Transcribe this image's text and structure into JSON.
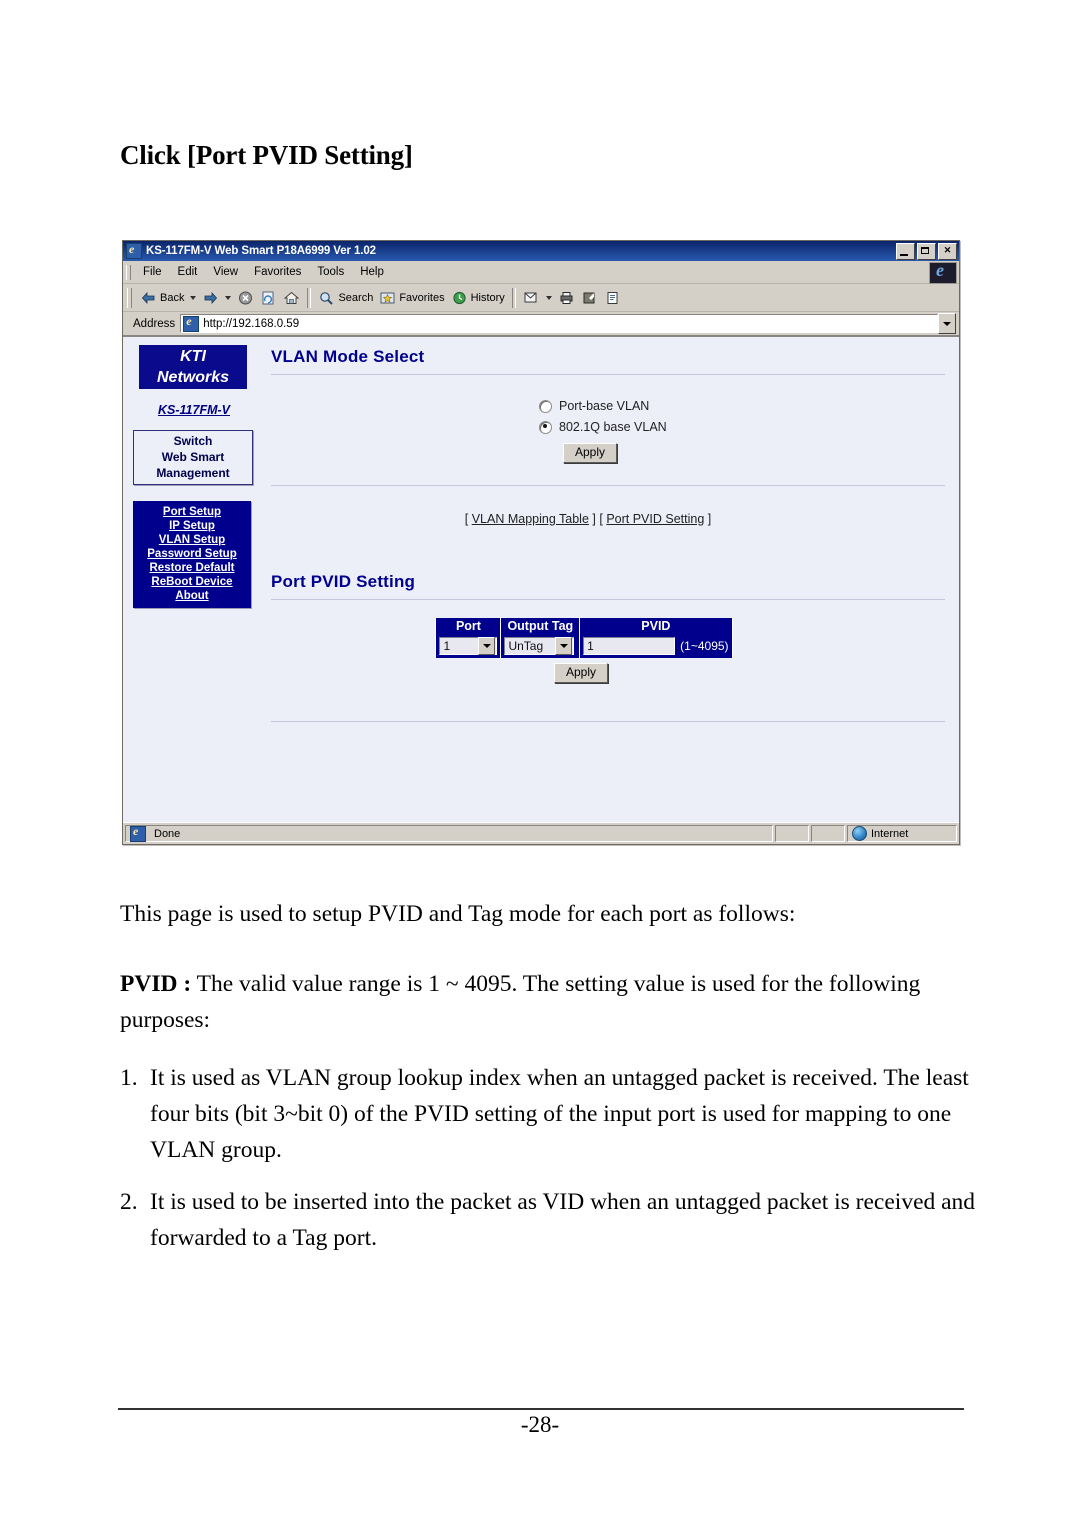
{
  "document": {
    "heading": "Click [Port PVID Setting]",
    "page_number": "-28-"
  },
  "browser": {
    "title": "KS-117FM-V Web Smart P18A6999 Ver 1.02",
    "window_controls": {
      "minimize": "_",
      "restore": "❐",
      "close": "✕"
    },
    "menu": [
      "File",
      "Edit",
      "View",
      "Favorites",
      "Tools",
      "Help"
    ],
    "toolbar": {
      "back": "Back",
      "forward": "",
      "stop": "",
      "refresh": "",
      "home": "",
      "search": "Search",
      "favorites": "Favorites",
      "history": "History"
    },
    "address": {
      "label": "Address",
      "value": "http://192.168.0.59"
    },
    "status": {
      "text": "Done",
      "zone": "Internet"
    }
  },
  "sidebar": {
    "logo_line1": "KTI",
    "logo_line2": "Networks",
    "model": "KS-117FM-V",
    "subtitle": [
      "Switch",
      "Web Smart",
      "Management"
    ],
    "menu_items": [
      "Port Setup",
      "IP Setup",
      "VLAN Setup",
      "Password Setup",
      "Restore Default",
      "ReBoot Device",
      "About"
    ]
  },
  "vlan_mode": {
    "title": "VLAN Mode Select",
    "options": [
      {
        "label": "Port-base VLAN",
        "selected": false
      },
      {
        "label": "802.1Q base VLAN",
        "selected": true
      }
    ],
    "apply_label": "Apply",
    "links": {
      "open_bracket": "[",
      "link1": "VLAN Mapping Table",
      "mid": "] [",
      "link2": "Port PVID Setting",
      "close_bracket": "]"
    }
  },
  "pvid_setting": {
    "title": "Port PVID Setting",
    "columns": [
      "Port",
      "Output Tag",
      "PVID"
    ],
    "row": {
      "port": "1",
      "output_tag": "UnTag",
      "pvid": "1",
      "range_note": "(1~4095)"
    },
    "apply_label": "Apply"
  },
  "body": {
    "lead": "This page is used to setup PVID and Tag mode for each port as follows:",
    "pvid_label": "PVID :",
    "pvid_desc": " The valid value range is 1 ~ 4095. The setting value is used for the following purposes:",
    "items": [
      {
        "num": "1.",
        "text": "It is used as VLAN group lookup index when an untagged packet is received. The least four bits (bit 3~bit 0) of the PVID setting of the input port is used for mapping to one VLAN group."
      },
      {
        "num": "2.",
        "text": "It is used to be inserted into the packet as VID when an untagged packet is received and forwarded to a Tag port."
      }
    ]
  },
  "colors": {
    "brand_navy": "#00008c",
    "page_bg": "#eceef8",
    "chrome": "#d4d0c8",
    "title_blue": "#0a246a"
  }
}
